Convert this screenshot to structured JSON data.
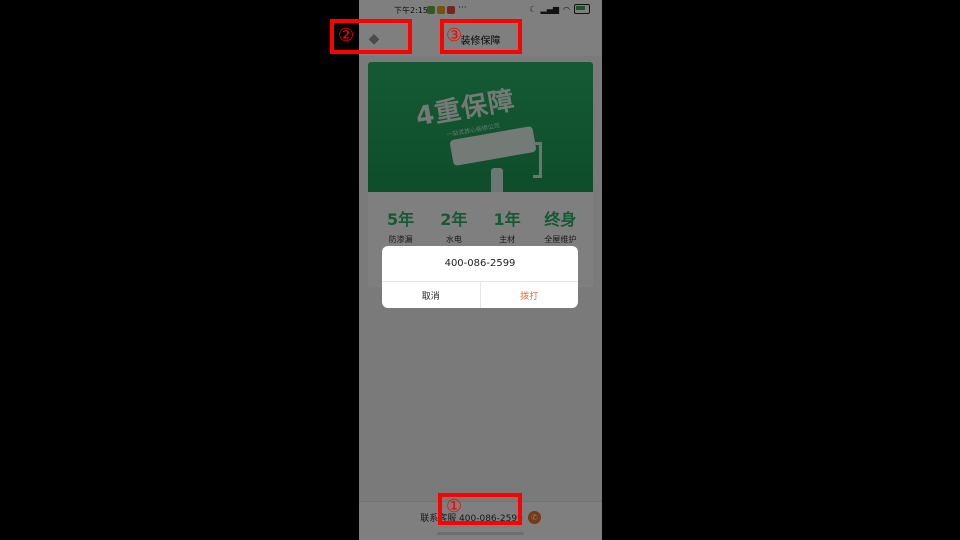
{
  "status_bar": {
    "time": "下午2:15",
    "more": "···",
    "app_colors": [
      "#6db33f",
      "#f0a020",
      "#e8503a"
    ]
  },
  "header": {
    "back_glyph": "◆",
    "title": "装修保障"
  },
  "banner": {
    "headline": "4重保障",
    "subline": "一站式放心装修公司"
  },
  "stats": [
    {
      "value": "5年",
      "label": "防渗漏"
    },
    {
      "value": "2年",
      "label": "水电"
    },
    {
      "value": "1年",
      "label": "主材"
    },
    {
      "value": "终身",
      "label": "全屋维护"
    }
  ],
  "footer": {
    "contact_text": "联系客服 400-086-2599",
    "icon": "phone-icon"
  },
  "dialog": {
    "number": "400-086-2599",
    "cancel_label": "取消",
    "call_label": "拨打"
  },
  "annotations": [
    {
      "label": "①"
    },
    {
      "label": "②"
    },
    {
      "label": "③"
    }
  ],
  "colors": {
    "accent_green": "#2db36a",
    "call_orange": "#f06a20",
    "annotation_red": "#ff0000"
  }
}
